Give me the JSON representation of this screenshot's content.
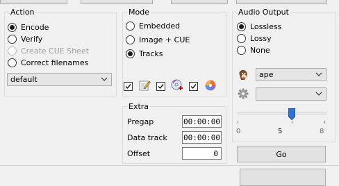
{
  "action": {
    "title": "Action",
    "items": [
      {
        "label": "Encode",
        "checked": true,
        "enabled": true
      },
      {
        "label": "Verify",
        "checked": false,
        "enabled": true
      },
      {
        "label": "Create CUE Sheet",
        "checked": false,
        "enabled": false
      },
      {
        "label": "Correct filenames",
        "checked": false,
        "enabled": true
      }
    ],
    "profile": "default"
  },
  "mode": {
    "title": "Mode",
    "items": [
      {
        "label": "Embedded",
        "checked": false
      },
      {
        "label": "Image + CUE",
        "checked": false
      },
      {
        "label": "Tracks",
        "checked": true
      }
    ],
    "toolbar_icons": [
      "checkbox-checked",
      "notepad-icon",
      "checkbox-checked",
      "cd-add-icon",
      "checkbox-checked",
      "disc-color-icon"
    ]
  },
  "audio_output": {
    "title": "Audio Output",
    "items": [
      {
        "label": "Lossless",
        "checked": true
      },
      {
        "label": "Lossy",
        "checked": false
      },
      {
        "label": "None",
        "checked": false
      }
    ],
    "encoder_format": "ape",
    "encoder": "",
    "slider": {
      "min": "0",
      "mid": "5",
      "max": "8",
      "value": 5,
      "max_value": 8
    }
  },
  "extra": {
    "title": "Extra",
    "pregap_label": "Pregap",
    "pregap_value": "00:00:00",
    "data_track_label": "Data track",
    "data_track_value": "00:00:00",
    "offset_label": "Offset",
    "offset_value": "0"
  },
  "go_button": "Go"
}
